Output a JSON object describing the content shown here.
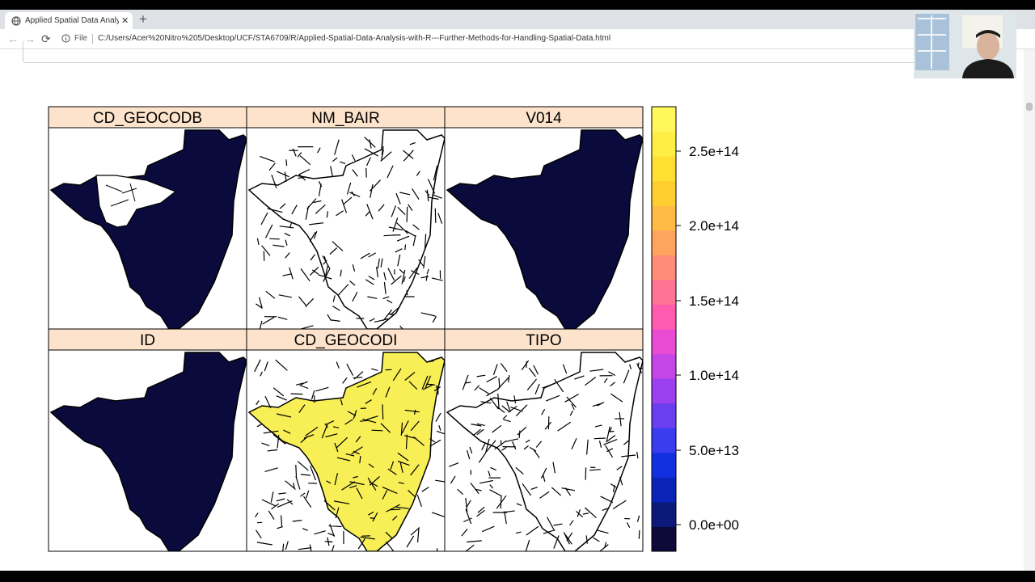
{
  "browser": {
    "tab_title": "Applied Spatial Data Analysis wit",
    "new_tab_label": "+",
    "close_label": "✕",
    "file_label": "File",
    "url": "C:/Users/Acer%20Nitro%205/Desktop/UCF/STA6709/R/Applied-Spatial-Data-Analysis-with-R---Further-Methods-for-Handling-Spatial-Data.html",
    "back_label": "←",
    "forward_label": "→",
    "reload_label": "⟳"
  },
  "plot": {
    "panels": [
      {
        "title": "CD_GEOCODB",
        "fill": "#0a0a3c"
      },
      {
        "title": "NM_BAIR",
        "fill": "#ffffff"
      },
      {
        "title": "V014",
        "fill": "#0a0a3c"
      },
      {
        "title": "ID",
        "fill": "#0a0a3c"
      },
      {
        "title": "CD_GEOCODI",
        "fill": "#f7ef55"
      },
      {
        "title": "TIPO",
        "fill": "#ffffff"
      }
    ],
    "strip_color": "#fde3cb",
    "colorbar": {
      "ticks": [
        "2.5e+14",
        "2.0e+14",
        "1.5e+14",
        "1.0e+14",
        "5.0e+13",
        "0.0e+00"
      ],
      "colors": [
        "#0d0a3a",
        "#0b1a7a",
        "#0b24b8",
        "#1230e0",
        "#3a3cf0",
        "#6a3ff0",
        "#9a40ee",
        "#c545e6",
        "#e94cd2",
        "#ff5cb0",
        "#ff7495",
        "#ff8c78",
        "#ffa45e",
        "#ffbb45",
        "#ffcf32",
        "#ffe032",
        "#ffee44",
        "#fff75c"
      ]
    }
  }
}
